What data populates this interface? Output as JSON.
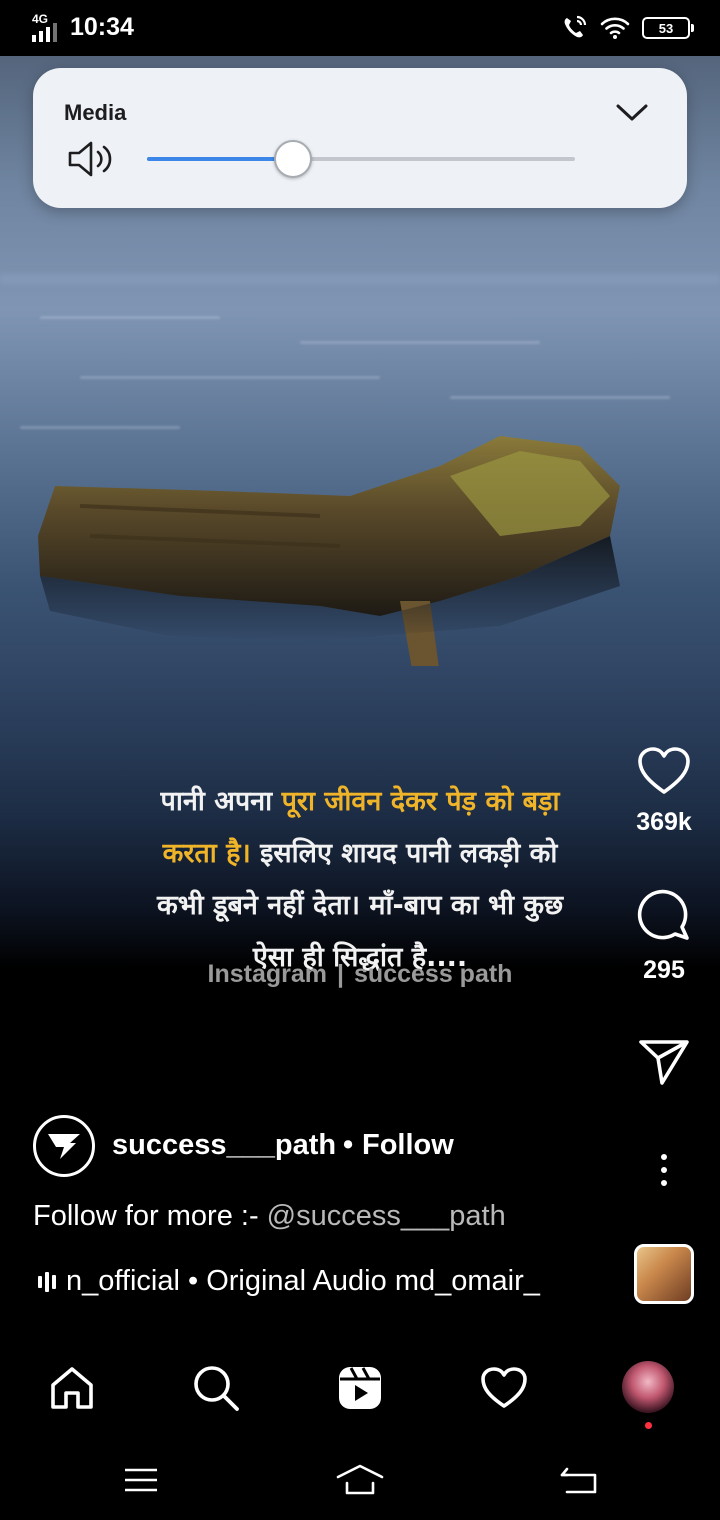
{
  "status_bar": {
    "network": "4G",
    "time": "10:34",
    "battery": "53"
  },
  "volume_panel": {
    "title": "Media",
    "level": 0.34
  },
  "reel": {
    "quote": {
      "line1_plain": "पानी अपना ",
      "line1_highlight": "पूरा जीवन देकर पेड़ को बड़ा",
      "line2_highlight": "करता है।",
      "line2_plain": " इसलिए शायद पानी लकड़ी को",
      "line3": "कभी डूबने नहीं देता। माँ-बाप का भी कुछ",
      "line4": "ऐसा ही सिद्धांत है...."
    },
    "credit": {
      "platform": "Instagram",
      "separator": "|",
      "account": "success path"
    },
    "likes": "369k",
    "comments": "295",
    "account": {
      "username": "success___path",
      "dot": "•",
      "follow_label": "Follow"
    },
    "caption": {
      "text": "Follow for more :- ",
      "mention": "@success___path"
    },
    "audio": {
      "text": "n_official • Original Audio   md_omair_"
    }
  },
  "bottom_nav": {
    "items": [
      "home-icon",
      "search-icon",
      "reels-icon",
      "activity-heart-icon",
      "profile-avatar"
    ]
  },
  "colors": {
    "highlight": "#f0b429",
    "slider": "#3b86e8",
    "notification": "#ff3040"
  }
}
